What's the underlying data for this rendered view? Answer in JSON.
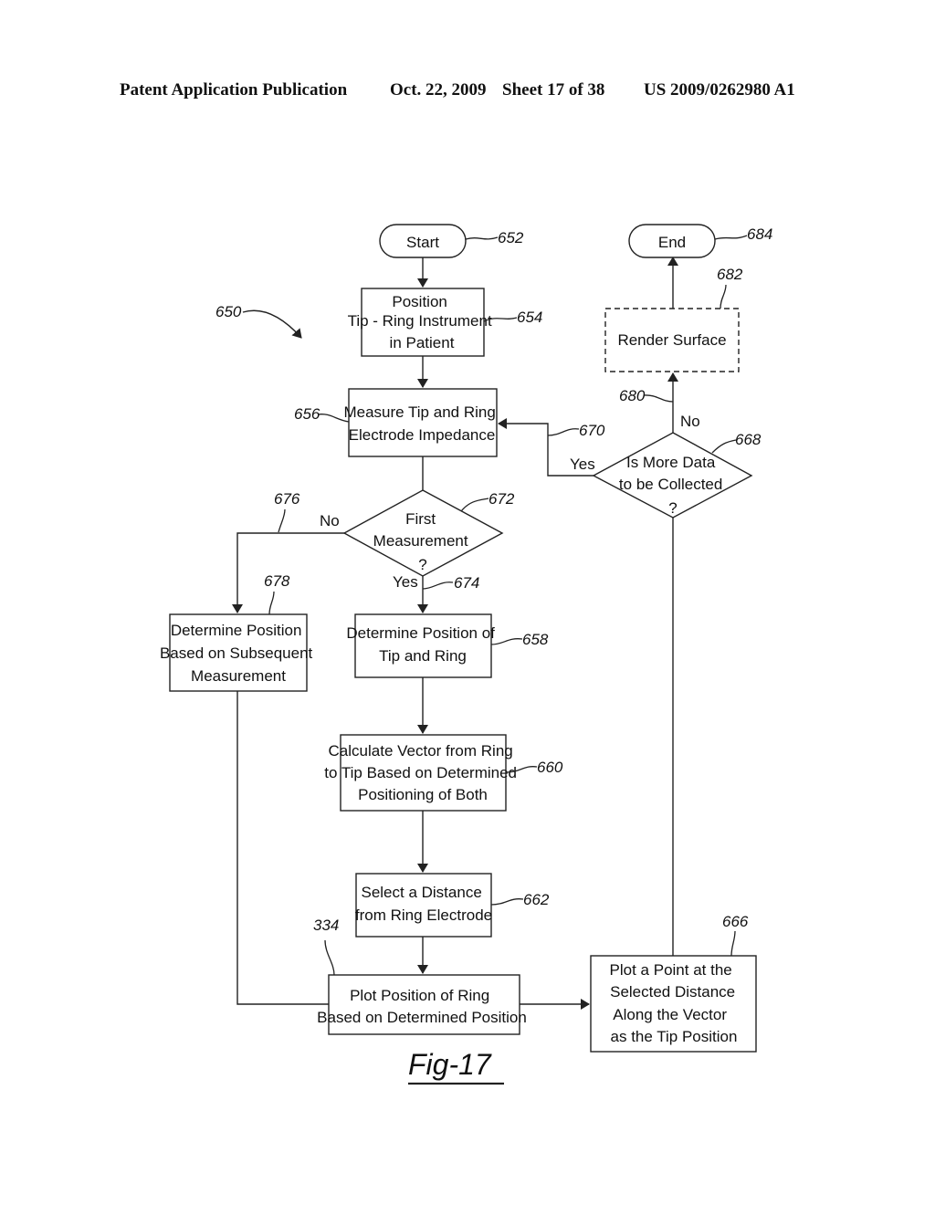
{
  "header": {
    "publication": "Patent Application Publication",
    "date": "Oct. 22, 2009",
    "sheet": "Sheet 17 of 38",
    "number": "US 2009/0262980 A1"
  },
  "figure": {
    "label": "Fig-17",
    "ref": "650"
  },
  "nodes": {
    "start": {
      "text": [
        "Start"
      ],
      "ref": "652"
    },
    "position": {
      "text": [
        "Position",
        "Tip - Ring Instrument",
        "in Patient"
      ],
      "ref": "654"
    },
    "measure": {
      "text": [
        "Measure Tip and Ring",
        "Electrode Impedance"
      ],
      "ref": "656"
    },
    "first": {
      "text": [
        "First",
        "Measurement",
        "?"
      ],
      "ref": "672"
    },
    "det_subseq": {
      "text": [
        "Determine Position",
        "Based on Subsequent",
        "Measurement"
      ],
      "ref": "678"
    },
    "det_tip_ring": {
      "text": [
        "Determine Position of",
        "Tip and Ring"
      ],
      "ref": "658"
    },
    "calc_vector": {
      "text": [
        "Calculate Vector from Ring",
        "to Tip Based on Determined",
        "Positioning of Both"
      ],
      "ref": "660"
    },
    "select_dist": {
      "text": [
        "Select a Distance",
        "from Ring Electrode"
      ],
      "ref": "662"
    },
    "plot_ring": {
      "text": [
        "Plot Position of Ring",
        "Based on Determined Position"
      ],
      "ref": "334"
    },
    "plot_point": {
      "text": [
        "Plot a Point at the",
        "Selected Distance",
        "Along the Vector",
        "as the Tip Position"
      ],
      "ref": "666"
    },
    "more_data": {
      "text": [
        "Is More Data",
        "to be Collected",
        "?"
      ],
      "ref": "668"
    },
    "render": {
      "text": [
        "Render Surface"
      ],
      "ref": "682"
    },
    "end": {
      "text": [
        "End"
      ],
      "ref": "684"
    }
  },
  "edges": {
    "no_first": {
      "label": "No",
      "ref": "676"
    },
    "yes_first": {
      "label": "Yes",
      "ref": "674"
    },
    "yes_more": {
      "label": "Yes",
      "ref": "670"
    },
    "no_more": {
      "label": "No",
      "ref": "680"
    }
  }
}
